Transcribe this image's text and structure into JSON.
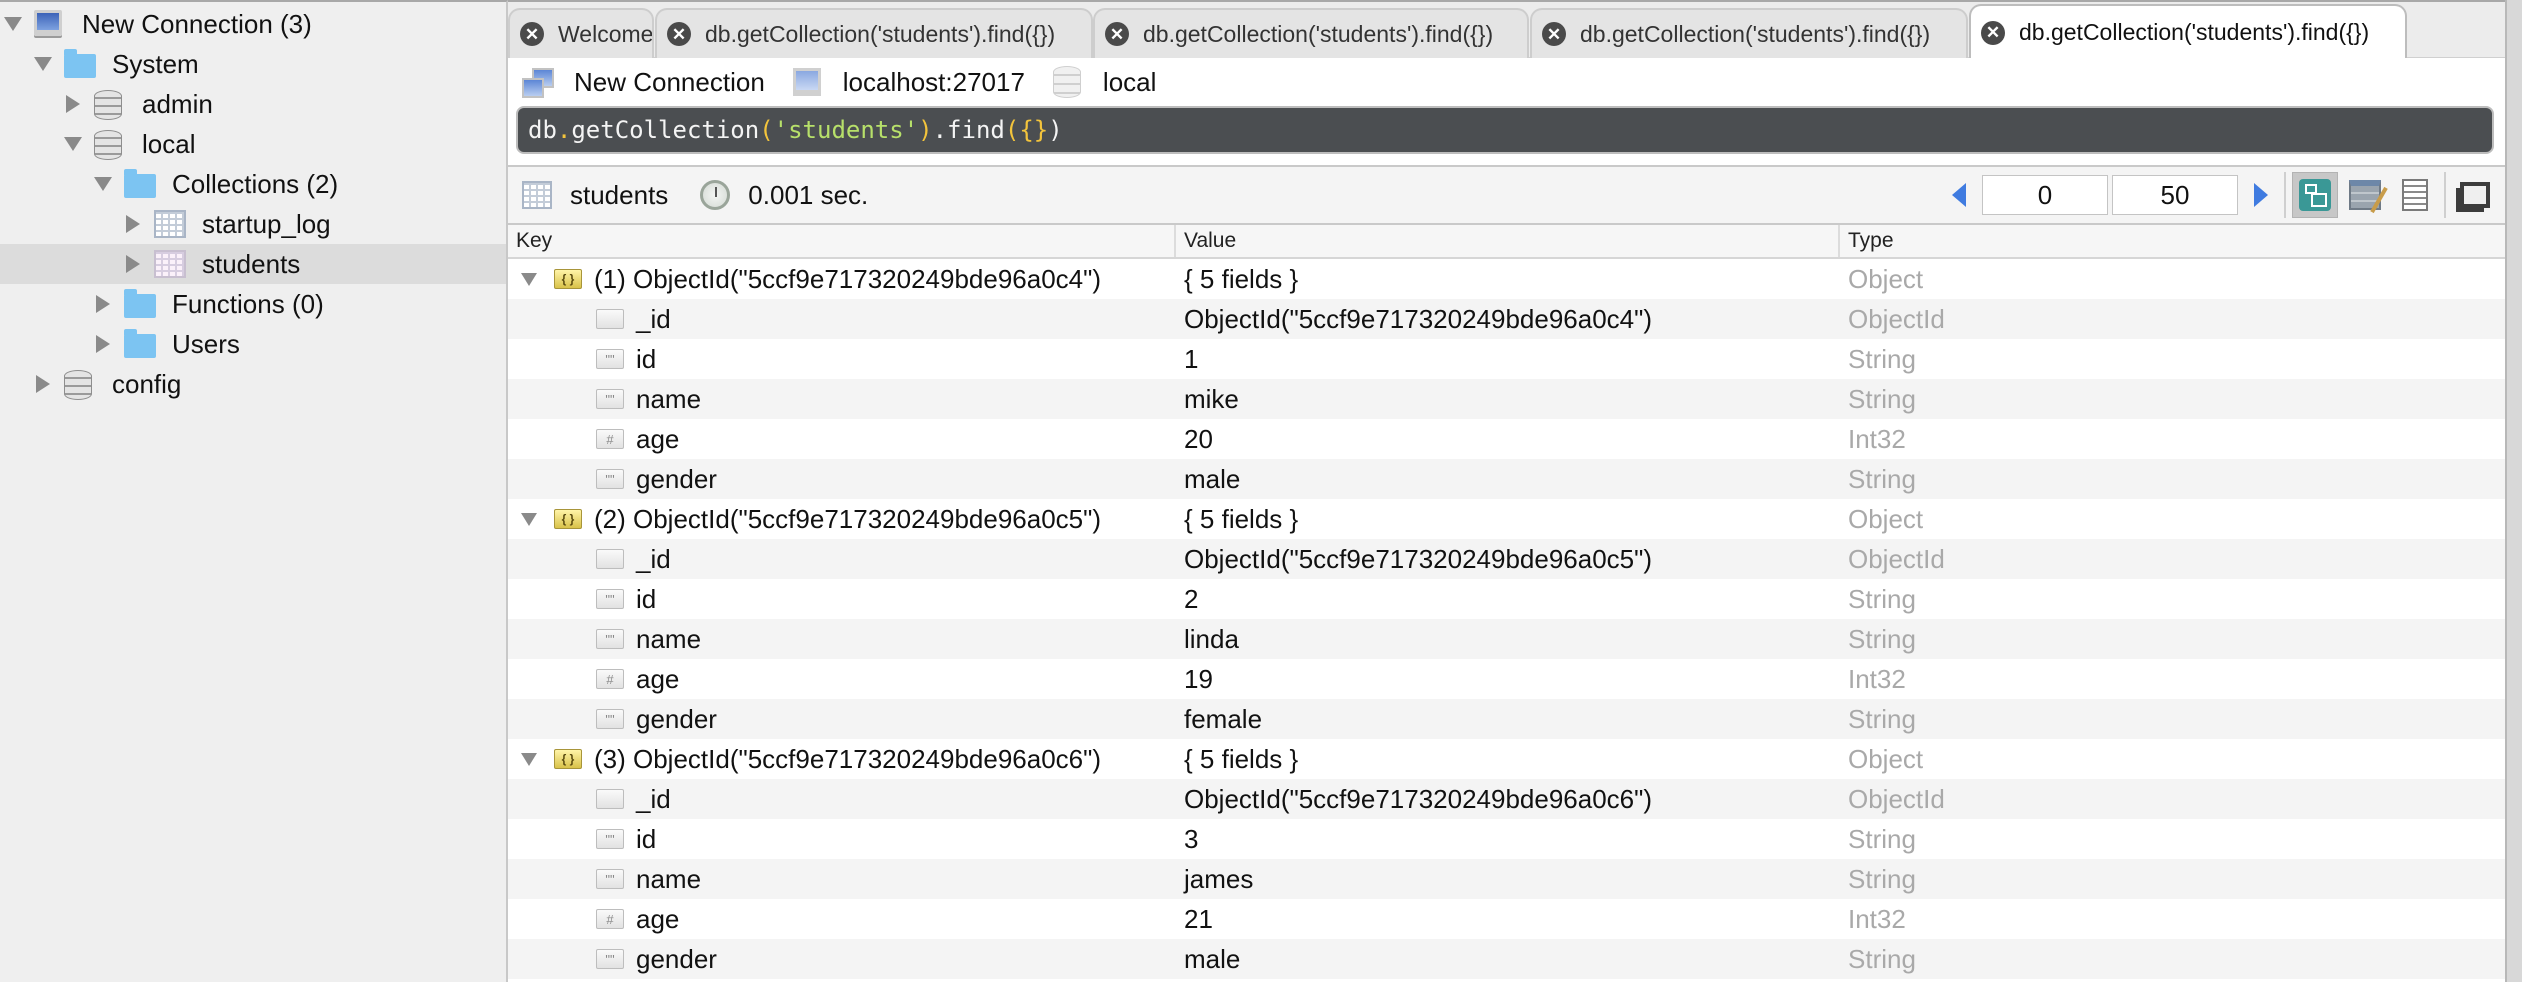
{
  "sidebar": {
    "items": [
      {
        "label": "New Connection (3)",
        "icon": "computer-icon",
        "expanded": true
      },
      {
        "label": "System",
        "icon": "folder-icon",
        "expanded": true
      },
      {
        "label": "admin",
        "icon": "database-icon",
        "expanded": false
      },
      {
        "label": "local",
        "icon": "database-icon",
        "expanded": true
      },
      {
        "label": "Collections (2)",
        "icon": "folder-icon",
        "expanded": true
      },
      {
        "label": "startup_log",
        "icon": "collection-icon",
        "expanded": false
      },
      {
        "label": "students",
        "icon": "collection-icon",
        "expanded": false,
        "selected": true
      },
      {
        "label": "Functions (0)",
        "icon": "folder-icon",
        "expanded": false
      },
      {
        "label": "Users",
        "icon": "folder-icon",
        "expanded": false
      },
      {
        "label": "config",
        "icon": "database-icon",
        "expanded": false
      }
    ]
  },
  "tabs": [
    {
      "label": "Welcome",
      "active": false
    },
    {
      "label": "db.getCollection('students').find({})",
      "active": false
    },
    {
      "label": "db.getCollection('students').find({})",
      "active": false
    },
    {
      "label": "db.getCollection('students').find({})",
      "active": false
    },
    {
      "label": "db.getCollection('students').find({})",
      "active": true
    }
  ],
  "connection_bar": {
    "connection": "New Connection",
    "host": "localhost:27017",
    "database": "local"
  },
  "query": {
    "tokens": [
      {
        "text": "db",
        "kind": "ident"
      },
      {
        "text": ".",
        "kind": "punct"
      },
      {
        "text": "getCollection",
        "kind": "ident"
      },
      {
        "text": "(",
        "kind": "punct"
      },
      {
        "text": "'students'",
        "kind": "str"
      },
      {
        "text": ")",
        "kind": "punct"
      },
      {
        "text": ".find",
        "kind": "ident"
      },
      {
        "text": "(",
        "kind": "punct"
      },
      {
        "text": "{}",
        "kind": "punct"
      },
      {
        "text": ")",
        "kind": "ident"
      }
    ]
  },
  "result_toolbar": {
    "collection": "students",
    "elapsed": "0.001 sec.",
    "skip": "0",
    "limit": "50",
    "views": [
      "tree-view",
      "table-view",
      "text-view"
    ],
    "active_view": "tree-view"
  },
  "grid": {
    "columns": [
      "Key",
      "Value",
      "Type"
    ],
    "rows": [
      {
        "level": 0,
        "icon": "object",
        "key": "(1) ObjectId(\"5ccf9e717320249bde96a0c4\")",
        "value": "{ 5 fields }",
        "type": "Object"
      },
      {
        "level": 1,
        "icon": "objectid",
        "key": "_id",
        "value": "ObjectId(\"5ccf9e717320249bde96a0c4\")",
        "type": "ObjectId"
      },
      {
        "level": 1,
        "icon": "string",
        "key": "id",
        "value": "1",
        "type": "String"
      },
      {
        "level": 1,
        "icon": "string",
        "key": "name",
        "value": "mike",
        "type": "String"
      },
      {
        "level": 1,
        "icon": "int",
        "key": "age",
        "value": "20",
        "type": "Int32"
      },
      {
        "level": 1,
        "icon": "string",
        "key": "gender",
        "value": "male",
        "type": "String"
      },
      {
        "level": 0,
        "icon": "object",
        "key": "(2) ObjectId(\"5ccf9e717320249bde96a0c5\")",
        "value": "{ 5 fields }",
        "type": "Object"
      },
      {
        "level": 1,
        "icon": "objectid",
        "key": "_id",
        "value": "ObjectId(\"5ccf9e717320249bde96a0c5\")",
        "type": "ObjectId"
      },
      {
        "level": 1,
        "icon": "string",
        "key": "id",
        "value": "2",
        "type": "String"
      },
      {
        "level": 1,
        "icon": "string",
        "key": "name",
        "value": "linda",
        "type": "String"
      },
      {
        "level": 1,
        "icon": "int",
        "key": "age",
        "value": "19",
        "type": "Int32"
      },
      {
        "level": 1,
        "icon": "string",
        "key": "gender",
        "value": "female",
        "type": "String"
      },
      {
        "level": 0,
        "icon": "object",
        "key": "(3) ObjectId(\"5ccf9e717320249bde96a0c6\")",
        "value": "{ 5 fields }",
        "type": "Object"
      },
      {
        "level": 1,
        "icon": "objectid",
        "key": "_id",
        "value": "ObjectId(\"5ccf9e717320249bde96a0c6\")",
        "type": "ObjectId"
      },
      {
        "level": 1,
        "icon": "string",
        "key": "id",
        "value": "3",
        "type": "String"
      },
      {
        "level": 1,
        "icon": "string",
        "key": "name",
        "value": "james",
        "type": "String"
      },
      {
        "level": 1,
        "icon": "int",
        "key": "age",
        "value": "21",
        "type": "Int32"
      },
      {
        "level": 1,
        "icon": "string",
        "key": "gender",
        "value": "male",
        "type": "String"
      }
    ]
  },
  "colors": {
    "query_bg": "#4b4e51",
    "query_punct": "#f3c43c",
    "query_string": "#b7e06a",
    "type_text": "#a9a9a9",
    "selected_tree_row": "#dcdcdc",
    "tree_view_active": "#3a9896"
  }
}
